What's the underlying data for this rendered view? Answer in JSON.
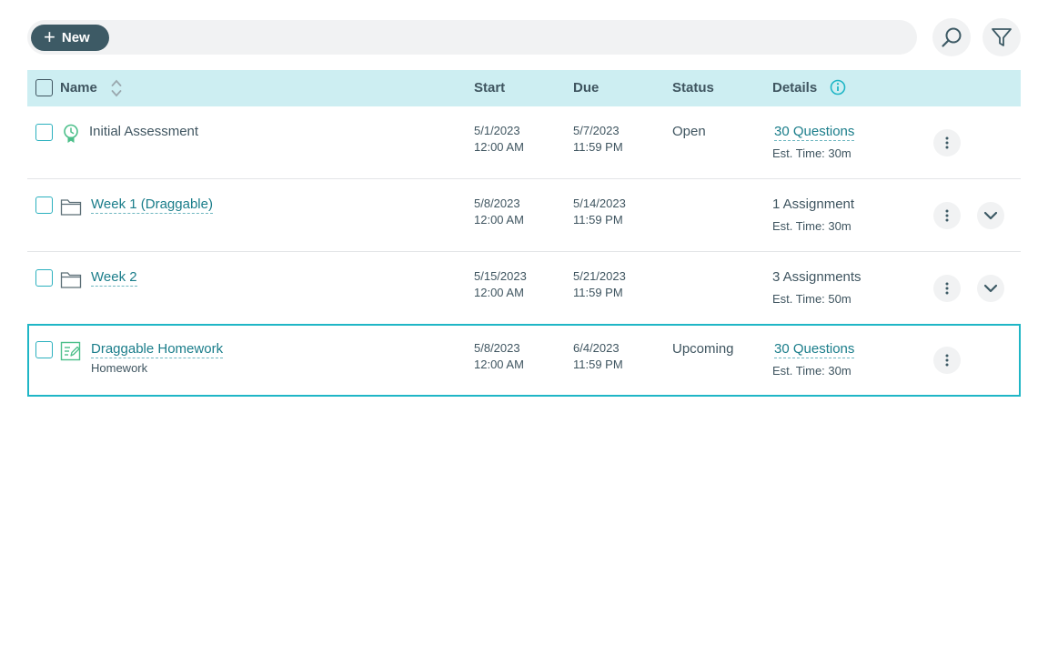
{
  "toolbar": {
    "new_label": "New",
    "search_icon": "search-icon",
    "filter_icon": "filter-icon"
  },
  "table": {
    "headers": {
      "name": "Name",
      "start": "Start",
      "due": "Due",
      "status": "Status",
      "details": "Details"
    },
    "rows": [
      {
        "name": "Initial Assessment",
        "icon": "assessment-badge-icon",
        "start_date": "5/1/2023",
        "start_time": "12:00 AM",
        "due_date": "5/7/2023",
        "due_time": "11:59 PM",
        "status": "Open",
        "details": "30 Questions",
        "est_time": "Est. Time: 30m"
      },
      {
        "name": "Week 1 (Draggable)",
        "icon": "folder-icon",
        "start_date": "5/8/2023",
        "start_time": "12:00 AM",
        "due_date": "5/14/2023",
        "due_time": "11:59 PM",
        "status": "",
        "details": "1 Assignment",
        "est_time": "Est. Time: 30m"
      },
      {
        "name": "Week 2",
        "icon": "folder-icon",
        "start_date": "5/15/2023",
        "start_time": "12:00 AM",
        "due_date": "5/21/2023",
        "due_time": "11:59 PM",
        "status": "",
        "details": "3 Assignments",
        "est_time": "Est. Time: 50m"
      },
      {
        "name": "Draggable Homework",
        "subtitle": "Homework",
        "icon": "homework-icon",
        "start_date": "5/8/2023",
        "start_time": "12:00 AM",
        "due_date": "6/4/2023",
        "due_time": "11:59 PM",
        "status": "Upcoming",
        "details": "30 Questions",
        "est_time": "Est. Time: 30m"
      }
    ]
  },
  "colors": {
    "accent": "#1fb6c6",
    "header_bg": "#cdeef2",
    "button_dark": "#3d5a65",
    "link": "#1a7d8a",
    "icon_green": "#4cbf8a"
  }
}
